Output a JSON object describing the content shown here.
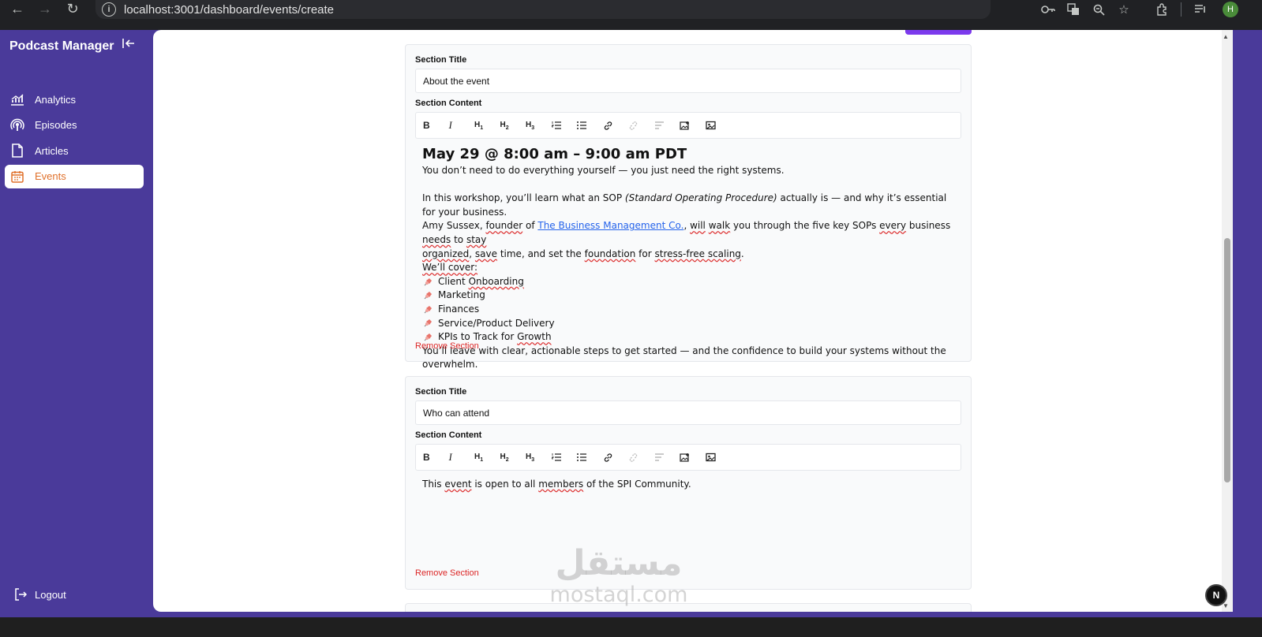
{
  "browser": {
    "url": "localhost:3001/dashboard/events/create",
    "profile_initial": "H"
  },
  "sidebar": {
    "brand": "Podcast Manager",
    "items": [
      {
        "label": "Analytics",
        "icon": "chart-icon"
      },
      {
        "label": "Episodes",
        "icon": "podcast-icon"
      },
      {
        "label": "Articles",
        "icon": "document-icon"
      },
      {
        "label": "Events",
        "icon": "calendar-icon",
        "active": true
      }
    ],
    "logout": "Logout",
    "active_color": "#e0702a"
  },
  "sections": [
    {
      "title_label": "Section Title",
      "title_value": "About the event",
      "content_label": "Section Content",
      "content": {
        "heading": "May 29 @ 8:00 am – 9:00 am PDT",
        "intro": "You don’t need to do everything yourself — you just need the right systems.",
        "p1_a": "In this workshop, you’ll learn what an SOP ",
        "p1_em": "(Standard Operating Procedure)",
        "p1_b": " actually is — and why it’s essential for your business.",
        "p2_a": "Amy Sussex, ",
        "p2_founder": "founder",
        "p2_of": " of ",
        "p2_link": "The Business Management Co.",
        "p2_b": ", ",
        "p2_will": "will",
        "p2_walk": " ",
        "p2_walk2": "walk",
        "p2_c": " you through the five key SOPs ",
        "p2_every": "every",
        "p2_d": " business ",
        "p2_needs": "needs",
        "p2_to": " to ",
        "p2_stay": "stay",
        "p3_org": "organized",
        "p3_a": ", ",
        "p3_save": "save",
        "p3_b": " time, and set the ",
        "p3_found": "foundation",
        "p3_c": " for ",
        "p3_stress": "stress-free scaling",
        "p3_d": ".",
        "cover": "We’ll cover:",
        "bullets": [
          "Client Onboarding",
          "Marketing",
          "Finances",
          "Service/Product Delivery",
          "KPIs to Track for Growth"
        ],
        "outro": "You’ll leave with clear, actionable steps to get started — and the confidence to build your systems without the overwhelm."
      },
      "remove": "Remove Section"
    },
    {
      "title_label": "Section Title",
      "title_value": "Who can attend",
      "content_label": "Section Content",
      "content": {
        "a": "This ",
        "event": "event",
        "b": " is open to all ",
        "members": "members",
        "c": " of the SPI Community."
      },
      "remove": "Remove Section"
    }
  ],
  "next_badge": "N",
  "watermark": {
    "arabic": "مستقل",
    "latin": "mostaql.com"
  }
}
